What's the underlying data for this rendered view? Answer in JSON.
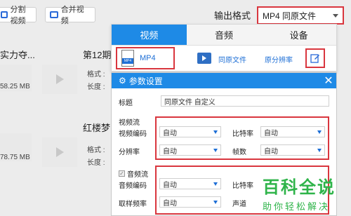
{
  "toolbar": {
    "split_label": "分割视频",
    "merge_label": "合并视频"
  },
  "output_format": {
    "label": "输出格式",
    "value": "MP4  同原文件"
  },
  "files": [
    {
      "name_partial": "实力夺...",
      "size": "58.25 MB"
    },
    {
      "name_partial": "第12期",
      "meta1": "格式 :",
      "meta2": "长度 :"
    },
    {
      "name_partial": "红楼梦",
      "meta1": "格式 :",
      "meta2": "长度 :"
    },
    {
      "size": "78.75 MB"
    }
  ],
  "format_panel": {
    "tabs": [
      "视频",
      "音频",
      "设备"
    ],
    "active_tab": "视频",
    "item_mp4": "MP4",
    "item_mp4_icon_text": "MP4",
    "same_as_source": "同原文件",
    "original_resolution": "原分辨率"
  },
  "dialog": {
    "title": "参数设置",
    "name_label": "标题",
    "name_value": "同原文件 自定义",
    "video_section": "视频流",
    "video_codec_label": "视频编码",
    "video_codec_value": "自动",
    "bitrate_label": "比特率",
    "bitrate_value": "自动",
    "resolution_label": "分辨率",
    "resolution_value": "自动",
    "framerate_label": "帧数",
    "framerate_value": "自动",
    "audio_section": "音频流",
    "audio_codec_label": "音频编码",
    "audio_codec_value": "自动",
    "audio_bitrate_label": "比特率",
    "samplerate_label": "取样频率",
    "samplerate_value": "自动",
    "channel_label": "声道"
  },
  "watermark": {
    "title": "百科全说",
    "subtitle": "助你轻松解决",
    "color": "#2fb44a"
  },
  "colors": {
    "accent": "#1e8ae6",
    "highlight": "#d9363e"
  }
}
